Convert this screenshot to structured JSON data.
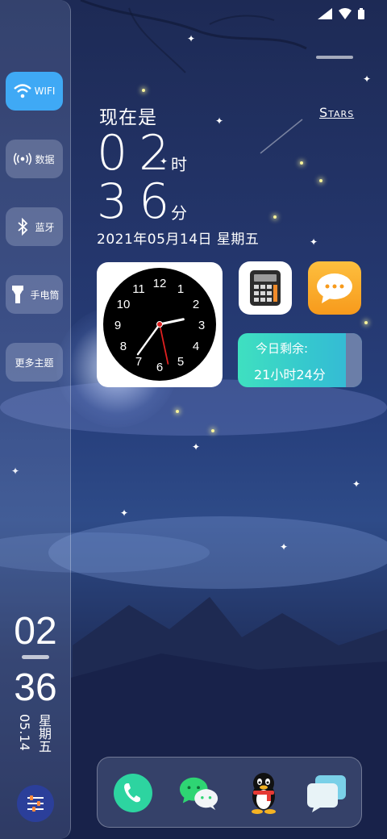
{
  "status_bar": {
    "icons": [
      "signal-icon",
      "wifi-icon",
      "battery-icon"
    ]
  },
  "side_panel": {
    "quick_settings": [
      {
        "label": "WIFI",
        "icon": "wifi-icon",
        "active": true
      },
      {
        "label": "数据",
        "icon": "mobile-data-icon",
        "active": false
      },
      {
        "label": "蓝牙",
        "icon": "bluetooth-icon",
        "active": false
      },
      {
        "label": "手电筒",
        "icon": "flashlight-icon",
        "active": false
      },
      {
        "label": "更多主题",
        "icon": "",
        "active": false
      }
    ],
    "clock": {
      "hour": "02",
      "minute": "36",
      "date": "05.14",
      "weekday": "星期五"
    },
    "settings_icon": "sliders-icon"
  },
  "main": {
    "now_label": "现在是",
    "theme_link": "Stars",
    "hour": "02",
    "hour_unit": "时",
    "minute": "36",
    "minute_unit": "分",
    "date_line": "2021年05月14日  星期五"
  },
  "clock_widget": {
    "numbers": [
      "12",
      "1",
      "2",
      "3",
      "4",
      "5",
      "6",
      "7",
      "8",
      "9",
      "10",
      "11"
    ],
    "time": {
      "hour": 2,
      "minute": 36
    }
  },
  "apps": {
    "calculator": "calculator-icon",
    "messages": "messages-icon"
  },
  "remaining": {
    "title": "今日剩余:",
    "value": "21小时24分",
    "fraction": 0.89
  },
  "dock": {
    "apps": [
      "phone-icon",
      "wechat-icon",
      "qq-icon",
      "chat-bubbles-icon"
    ]
  },
  "colors": {
    "wifi_active": "#3fa9f5",
    "remaining_gradient_start": "#3fe0c0",
    "remaining_gradient_end": "#35bcd4",
    "messages_orange": "#f79a1c",
    "phone_green": "#2dd4a0"
  }
}
